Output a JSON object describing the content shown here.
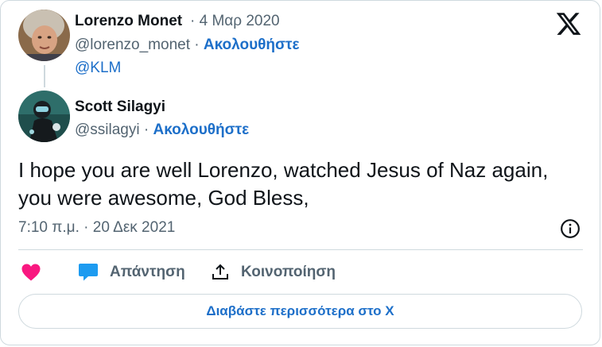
{
  "reply_to": {
    "name": "Lorenzo Monet",
    "date": "· 4 Μαρ 2020",
    "handle": "@lorenzo_monet",
    "separator": "·",
    "follow_label": "Ακολουθήστε",
    "mention": "@KLM"
  },
  "tweet": {
    "name": "Scott Silagyi",
    "handle": "@ssilagyi",
    "separator": "·",
    "follow_label": "Ακολουθήστε",
    "text_line1": "I hope you are well Lorenzo, watched Jesus of Naz again,",
    "text_line2": "you were awesome, God Bless,",
    "timestamp": "7:10 π.μ. · 20 Δεκ 2021"
  },
  "actions": {
    "like_icon": "heart-icon",
    "reply_label": "Απάντηση",
    "share_label": "Κοινοποίηση"
  },
  "read_more_label": "Διαβάστε περισσότερα στο X",
  "colors": {
    "link": "#1d6fc9",
    "heart": "#f91880",
    "reply_bubble": "#1d9bf0",
    "muted": "#536471",
    "border": "#cfd9de"
  }
}
